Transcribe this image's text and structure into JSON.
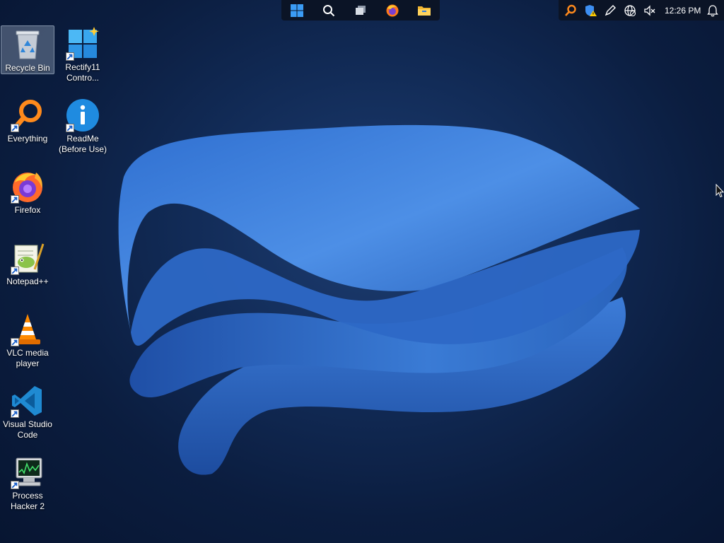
{
  "desktop_icons": [
    {
      "label": "Recycle Bin",
      "icon": "recycle-bin-icon"
    },
    {
      "label": "Rectify11\nContro...",
      "icon": "rectify11-control-panel-icon"
    },
    {
      "label": "Everything",
      "icon": "everything-search-icon"
    },
    {
      "label": "ReadMe\n(Before Use)",
      "icon": "readme-info-icon"
    },
    {
      "label": "Firefox",
      "icon": "firefox-icon"
    },
    {
      "label": "Notepad++",
      "icon": "notepad-plus-plus-icon"
    },
    {
      "label": "VLC media\nplayer",
      "icon": "vlc-icon"
    },
    {
      "label": "Visual Studio\nCode",
      "icon": "vscode-icon"
    },
    {
      "label": "Process\nHacker 2",
      "icon": "process-hacker-icon"
    }
  ],
  "taskbar": {
    "buttons": [
      "start-icon",
      "search-icon",
      "task-view-icon",
      "firefox-icon",
      "file-explorer-icon"
    ]
  },
  "tray": {
    "icons": [
      "everything-tray-icon",
      "security-warning-icon",
      "pen-icon",
      "network-globe-icon",
      "volume-muted-icon",
      "notification-bell-icon"
    ],
    "clock": "12:26 PM"
  },
  "colors": {
    "accent": "#3a7bd5",
    "background": "#0b1d3f",
    "taskbar": "#0b1426"
  }
}
